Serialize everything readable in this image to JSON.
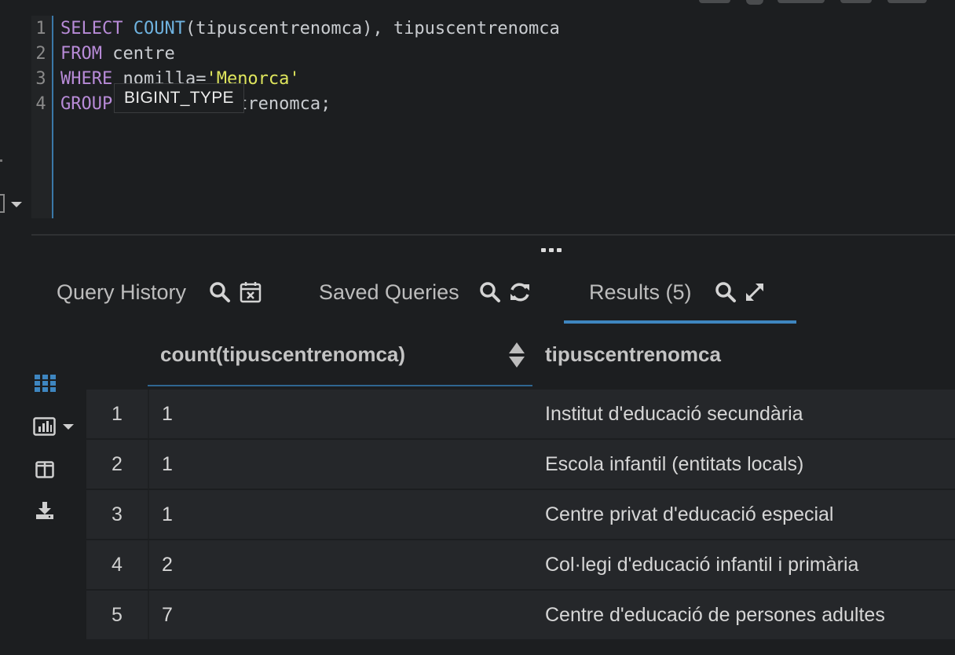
{
  "editor": {
    "line_numbers": [
      "1",
      "2",
      "3",
      "4"
    ],
    "lines": [
      {
        "kw1": "SELECT",
        "fn": "COUNT",
        "rest": "(tipuscentrenomca), tipuscentrenomca"
      },
      {
        "kw1": "FROM",
        "rest": " centre"
      },
      {
        "kw1": "WHERE",
        "rest": " nomilla=",
        "str": "'Menorca'"
      },
      {
        "kw1": "GROUP",
        "rest": " BY tipuscentrenomca;"
      }
    ],
    "tooltip": "BIGINT_TYPE"
  },
  "tabs": [
    {
      "label": "Query History",
      "icons": [
        "search-icon",
        "calendar-clear-icon"
      ]
    },
    {
      "label": "Saved Queries",
      "icons": [
        "search-icon",
        "refresh-icon"
      ]
    },
    {
      "label": "Results (5)",
      "icons": [
        "search-icon",
        "expand-icon"
      ],
      "active": true
    }
  ],
  "side_toolbar": [
    "grid-view-icon",
    "chart-icon",
    "columns-icon",
    "download-icon"
  ],
  "results": {
    "columns": [
      "count(tipuscentrenomca)",
      "tipuscentrenomca"
    ],
    "rows": [
      {
        "index": "1",
        "count": "1",
        "tipus": "Institut d'educació secundària"
      },
      {
        "index": "2",
        "count": "1",
        "tipus": "Escola infantil (entitats locals)"
      },
      {
        "index": "3",
        "count": "1",
        "tipus": "Centre privat d'educació especial"
      },
      {
        "index": "4",
        "count": "2",
        "tipus": "Col·legi d'educació infantil i primària"
      },
      {
        "index": "5",
        "count": "7",
        "tipus": "Centre d'educació de persones adultes"
      }
    ]
  },
  "colors": {
    "accent": "#3e86c0",
    "keyword": "#b88bd8",
    "function": "#6fb3e0",
    "string": "#dfe65d"
  }
}
